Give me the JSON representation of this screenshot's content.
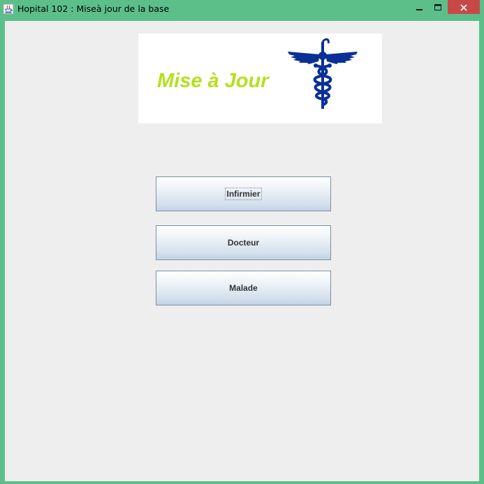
{
  "window": {
    "title": "Hopital 102 : Miseà jour de la base",
    "icon": "java-cup-icon",
    "controls": [
      "minimize-icon",
      "maximize-icon",
      "close-icon"
    ],
    "titlebar_color": "#5cbf8a",
    "close_color": "#c84848"
  },
  "banner": {
    "text": "Mise à Jour",
    "text_color": "#b5e01e",
    "icon": "caduceus-icon",
    "icon_color": "#0a2f96"
  },
  "buttons": {
    "infirmier": "Infirmier",
    "docteur": "Docteur",
    "malade": "Malade"
  }
}
